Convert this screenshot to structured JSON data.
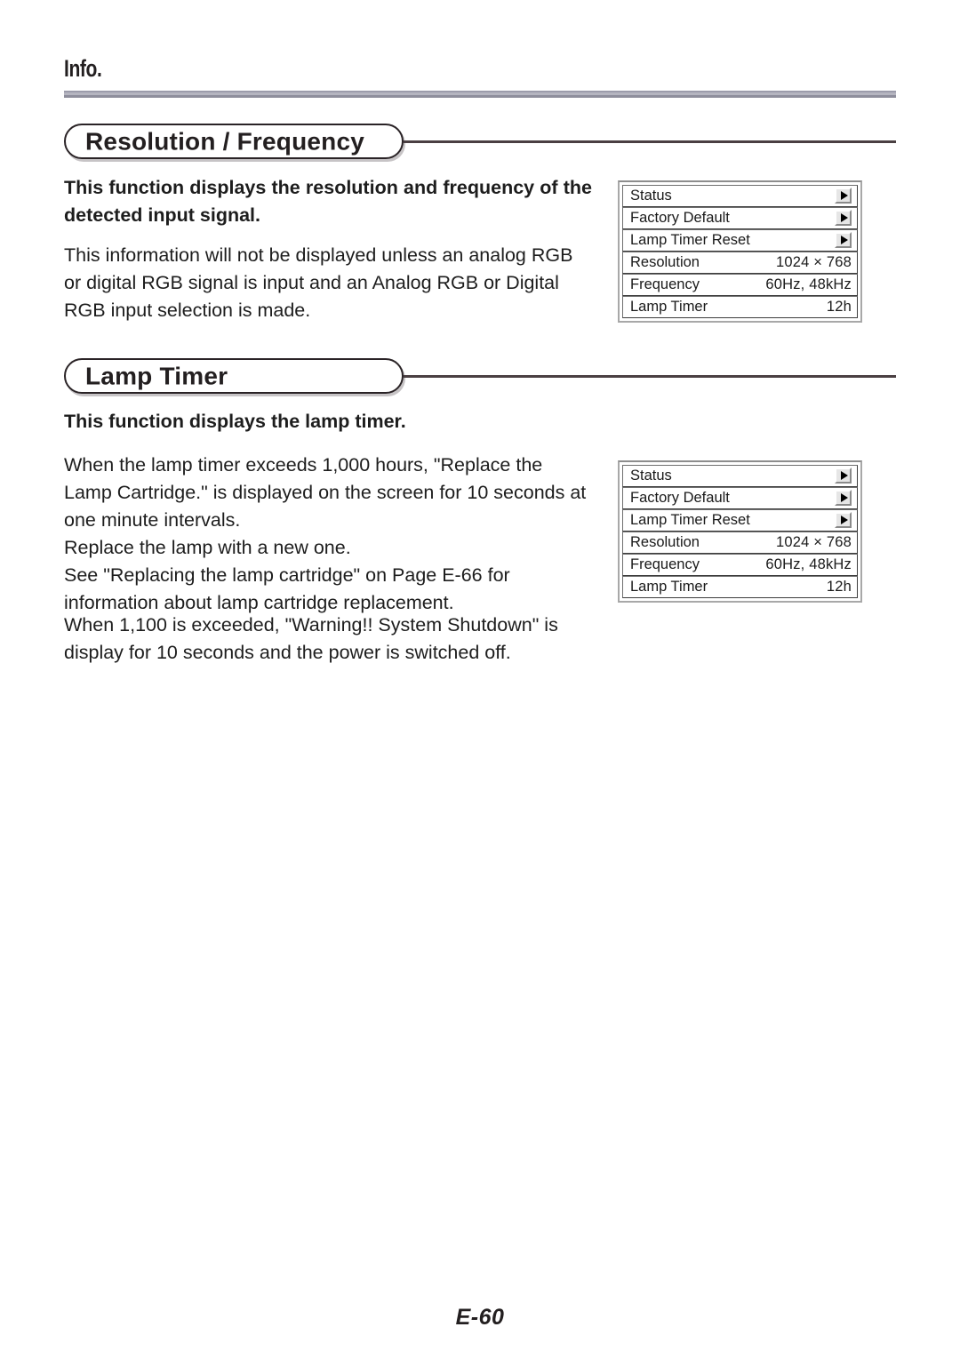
{
  "header": {
    "running_head": "Info."
  },
  "sections": [
    {
      "title": "Resolution / Frequency",
      "paragraphs": [
        "This function displays the resolution and frequency of the detected input signal.",
        "This information will not be displayed unless an analog RGB or digital RGB signal is input and an Analog RGB or Digital RGB input selection is made."
      ]
    },
    {
      "title": "Lamp Timer",
      "paragraphs": [
        "This function displays the lamp timer.",
        "When the lamp timer exceeds 1,000 hours, \"Replace the Lamp Cartridge.\" is displayed on the screen for 10 seconds at one minute intervals.\nReplace the lamp with a new one.\nSee \"Replacing the lamp cartridge\" on Page E-66 for information about lamp cartridge replacement.",
        "When 1,100 is exceeded, \"Warning!! System Shutdown\" is display for 10 seconds and the power is switched off."
      ]
    }
  ],
  "osd_menu": {
    "rows": [
      {
        "label": "Status",
        "value": "",
        "control": "right-arrow"
      },
      {
        "label": "Factory Default",
        "value": "",
        "control": "right-arrow"
      },
      {
        "label": "Lamp Timer Reset",
        "value": "",
        "control": "right-arrow"
      },
      {
        "label": "Resolution",
        "value": "1024 × 768",
        "control": "none"
      },
      {
        "label": "Frequency",
        "value": "60Hz, 48kHz",
        "control": "none"
      },
      {
        "label": "Lamp Timer",
        "value": "12h",
        "control": "none"
      }
    ]
  },
  "footer": {
    "page_number": "E-60"
  }
}
